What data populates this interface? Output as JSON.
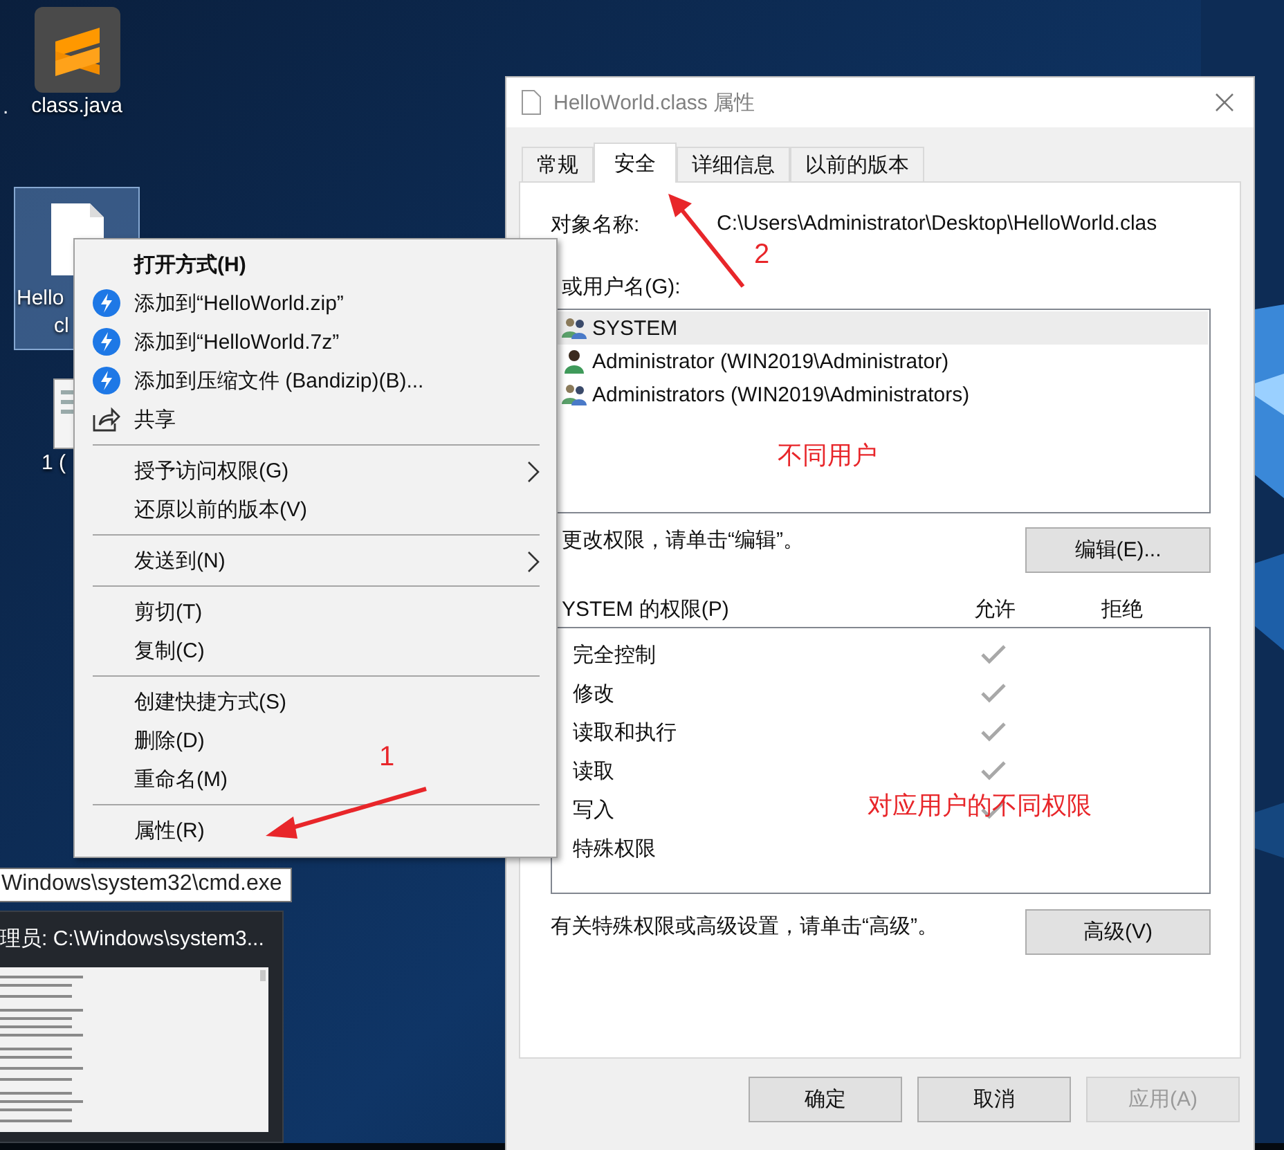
{
  "desktop": {
    "edge_label": ".",
    "icons": [
      {
        "kind": "app",
        "label_lines": [
          "class.java"
        ],
        "selected": false
      },
      {
        "kind": "file",
        "label_lines": [
          "Hello",
          "cl"
        ],
        "selected": true
      },
      {
        "kind": "document",
        "label_lines": [
          "1 ("
        ],
        "selected": false
      }
    ]
  },
  "context_menu": {
    "items": [
      {
        "kind": "item",
        "label": "打开方式(H)",
        "bold": true,
        "submenu": false
      },
      {
        "kind": "archive_item",
        "label": "添加到“HelloWorld.zip”",
        "bold": false,
        "submenu": false
      },
      {
        "kind": "archive_item",
        "label": "添加到“HelloWorld.7z”",
        "bold": false,
        "submenu": false
      },
      {
        "kind": "archive_item",
        "label": "添加到压缩文件 (Bandizip)(B)...",
        "bold": false,
        "submenu": false
      },
      {
        "kind": "share_item",
        "label": "共享",
        "bold": false,
        "submenu": false
      },
      {
        "kind": "separator"
      },
      {
        "kind": "item",
        "label": "授予访问权限(G)",
        "bold": false,
        "submenu": true
      },
      {
        "kind": "item",
        "label": "还原以前的版本(V)",
        "bold": false,
        "submenu": false
      },
      {
        "kind": "separator"
      },
      {
        "kind": "item",
        "label": "发送到(N)",
        "bold": false,
        "submenu": true
      },
      {
        "kind": "separator"
      },
      {
        "kind": "item",
        "label": "剪切(T)",
        "bold": false,
        "submenu": false
      },
      {
        "kind": "item",
        "label": "复制(C)",
        "bold": false,
        "submenu": false
      },
      {
        "kind": "separator"
      },
      {
        "kind": "item",
        "label": "创建快捷方式(S)",
        "bold": false,
        "submenu": false
      },
      {
        "kind": "item",
        "label": "删除(D)",
        "bold": false,
        "submenu": false
      },
      {
        "kind": "item",
        "label": "重命名(M)",
        "bold": false,
        "submenu": false
      },
      {
        "kind": "separator"
      },
      {
        "kind": "item",
        "label": "属性(R)",
        "bold": false,
        "submenu": false
      }
    ]
  },
  "tooltip": "Windows\\system32\\cmd.exe",
  "taskbar_preview": {
    "title": "理员: C:\\Windows\\system3..."
  },
  "dialog": {
    "title": "HelloWorld.class 属性",
    "tabs": [
      {
        "label": "常规",
        "selected": false
      },
      {
        "label": "安全",
        "selected": true
      },
      {
        "label": "详细信息",
        "selected": false
      },
      {
        "label": "以前的版本",
        "selected": false
      }
    ],
    "object_label": "对象名称:",
    "object_value": "C:\\Users\\Administrator\\Desktop\\HelloWorld.clas",
    "groups_label": "或用户名(G):",
    "users": [
      {
        "name": "SYSTEM",
        "kind": "group",
        "selected": true
      },
      {
        "name": "Administrator (WIN2019\\Administrator)",
        "kind": "user",
        "selected": false
      },
      {
        "name": "Administrators (WIN2019\\Administrators)",
        "kind": "group",
        "selected": false
      }
    ],
    "edit_hint": "更改权限，请单击“编辑”。",
    "edit_button": "编辑(E)...",
    "permissions_label": "YSTEM 的权限(P)",
    "allow_header": "允许",
    "deny_header": "拒绝",
    "permissions": [
      {
        "name": "完全控制",
        "allow": true
      },
      {
        "name": "修改",
        "allow": true
      },
      {
        "name": "读取和执行",
        "allow": true
      },
      {
        "name": "读取",
        "allow": true
      },
      {
        "name": "写入",
        "allow": true
      },
      {
        "name": "特殊权限",
        "allow": false
      }
    ],
    "advanced_hint": "有关特殊权限或高级设置，请单击“高级”。",
    "advanced_button": "高级(V)",
    "buttons": [
      {
        "label": "确定",
        "disabled": false
      },
      {
        "label": "取消",
        "disabled": false
      },
      {
        "label": "应用(A)",
        "disabled": true
      }
    ]
  },
  "annotations": [
    {
      "text": "1"
    },
    {
      "text": "2"
    },
    {
      "text": "不同用户"
    },
    {
      "text": "对应用户的不同权限"
    }
  ]
}
